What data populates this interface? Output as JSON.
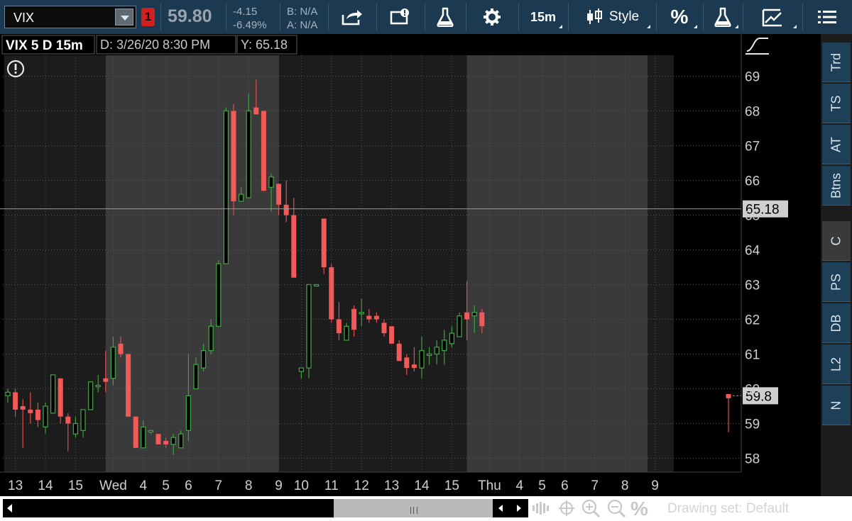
{
  "toolbar": {
    "symbol": "VIX",
    "alert_badge": "1",
    "last_price": "59.80",
    "net_change": "-4.15",
    "pct_change": "-6.49%",
    "bid": "B: N/A",
    "ask": "A: N/A",
    "timeframe_label": "15m",
    "style_label": "Style",
    "percent_label": "%",
    "icons": [
      "share-icon",
      "message-center-icon",
      "flask-icon",
      "gear-icon",
      "candle-style-icon",
      "flask-icon",
      "drawing-tools-icon",
      "menu-icon"
    ]
  },
  "chart_header": {
    "title": "VIX 5 D 15m",
    "date_readout": "D: 3/26/20 8:30 PM",
    "y_readout": "Y: 65.18"
  },
  "bottom": {
    "drawing_set": "Drawing set: Default"
  },
  "sidebar": {
    "tabs": [
      "Trd",
      "TS",
      "AT",
      "Btns",
      "C",
      "PS",
      "DB",
      "L2",
      "N"
    ],
    "active": "C"
  },
  "chart_data": {
    "type": "candlestick",
    "ylim": [
      57.7,
      69.5
    ],
    "y_ticks": [
      58,
      59,
      60,
      61,
      62,
      63,
      64,
      65,
      66,
      67,
      68,
      69
    ],
    "x_ticks": [
      {
        "label": "13",
        "i": 1
      },
      {
        "label": "14",
        "i": 5
      },
      {
        "label": "15",
        "i": 9
      },
      {
        "label": "Wed",
        "i": 14
      },
      {
        "label": "4",
        "i": 18
      },
      {
        "label": "5",
        "i": 21
      },
      {
        "label": "6",
        "i": 24
      },
      {
        "label": "7",
        "i": 28
      },
      {
        "label": "8",
        "i": 32
      },
      {
        "label": "9",
        "i": 36
      },
      {
        "label": "10",
        "i": 39
      },
      {
        "label": "11",
        "i": 43
      },
      {
        "label": "12",
        "i": 47
      },
      {
        "label": "13",
        "i": 51
      },
      {
        "label": "14",
        "i": 55
      },
      {
        "label": "15",
        "i": 59
      },
      {
        "label": "Thu",
        "i": 64
      },
      {
        "label": "4",
        "i": 68
      },
      {
        "label": "5",
        "i": 71
      },
      {
        "label": "6",
        "i": 74
      },
      {
        "label": "7",
        "i": 78
      },
      {
        "label": "8",
        "i": 82
      },
      {
        "label": "9",
        "i": 86
      }
    ],
    "session_shading": [
      {
        "from": 0,
        "to": 13,
        "tone": "dark"
      },
      {
        "from": 13.5,
        "to": 36.5,
        "tone": "light"
      },
      {
        "from": 36.5,
        "to": 61.5,
        "tone": "dark"
      },
      {
        "from": 61.5,
        "to": 85.5,
        "tone": "light"
      },
      {
        "from": 85.5,
        "to": 88,
        "tone": "dark"
      }
    ],
    "crosshair_value": 65.18,
    "crosshair_label": "65.18",
    "last_value": 59.8,
    "last_label": "59.8",
    "ohlc": [
      [
        59.8,
        60.0,
        59.6,
        59.9
      ],
      [
        59.9,
        60.0,
        59.2,
        59.4
      ],
      [
        59.5,
        59.7,
        58.3,
        59.4
      ],
      [
        59.4,
        59.9,
        59.0,
        59.3
      ],
      [
        59.4,
        59.6,
        58.9,
        59.1
      ],
      [
        58.9,
        59.6,
        58.7,
        59.5
      ],
      [
        59.3,
        60.4,
        59.3,
        60.4
      ],
      [
        60.3,
        60.3,
        59.0,
        59.2
      ],
      [
        59.2,
        59.3,
        58.2,
        59.0
      ],
      [
        58.7,
        59.2,
        58.6,
        59.0
      ],
      [
        58.8,
        59.3,
        58.6,
        59.4
      ],
      [
        59.4,
        60.2,
        59.4,
        60.2
      ],
      [
        60.1,
        60.4,
        59.9,
        60.1
      ],
      [
        60.3,
        61.1,
        59.9,
        60.2
      ],
      [
        60.3,
        61.5,
        60.1,
        61.2
      ],
      [
        61.3,
        61.5,
        60.9,
        61.0
      ],
      [
        61.0,
        61.0,
        59.2,
        59.2
      ],
      [
        59.2,
        59.2,
        58.3,
        58.3
      ],
      [
        58.3,
        59.1,
        58.3,
        58.9
      ],
      [
        58.8,
        58.8,
        58.7,
        58.8
      ],
      [
        58.7,
        58.7,
        58.4,
        58.4
      ],
      [
        58.5,
        58.6,
        58.3,
        58.4
      ],
      [
        58.4,
        58.7,
        58.1,
        58.6
      ],
      [
        58.3,
        58.8,
        58.3,
        58.7
      ],
      [
        58.8,
        61.0,
        58.5,
        59.8
      ],
      [
        60.0,
        60.9,
        60.0,
        60.7
      ],
      [
        60.6,
        61.3,
        60.5,
        61.1
      ],
      [
        61.1,
        62.0,
        61.0,
        61.8
      ],
      [
        61.8,
        63.7,
        61.8,
        63.6
      ],
      [
        63.6,
        68.1,
        63.6,
        68.0
      ],
      [
        68.0,
        68.2,
        65.0,
        65.4
      ],
      [
        65.4,
        65.8,
        65.4,
        65.6
      ],
      [
        65.5,
        68.5,
        65.5,
        68.0
      ],
      [
        68.1,
        68.9,
        68.0,
        67.9
      ],
      [
        68.0,
        68.0,
        65.8,
        65.7
      ],
      [
        65.8,
        66.2,
        65.1,
        66.1
      ],
      [
        65.9,
        65.9,
        65.0,
        65.3
      ],
      [
        65.3,
        66.0,
        64.8,
        65.0
      ],
      [
        65.0,
        65.5,
        63.2,
        63.2
      ],
      [
        60.5,
        60.6,
        60.3,
        60.6
      ],
      [
        60.6,
        63.0,
        60.3,
        63.0
      ],
      [
        63.0,
        63.0,
        63.0,
        63.0
      ],
      [
        64.9,
        64.9,
        63.3,
        63.5
      ],
      [
        63.5,
        63.6,
        61.9,
        62.0
      ],
      [
        62.0,
        62.5,
        61.4,
        61.6
      ],
      [
        61.4,
        61.9,
        61.4,
        61.8
      ],
      [
        62.3,
        62.4,
        61.5,
        61.7
      ],
      [
        62.2,
        62.6,
        61.8,
        62.2
      ],
      [
        62.1,
        62.3,
        61.9,
        62.0
      ],
      [
        62.1,
        62.2,
        61.9,
        62.0
      ],
      [
        61.9,
        62.0,
        61.5,
        61.6
      ],
      [
        61.8,
        61.8,
        61.3,
        61.3
      ],
      [
        61.3,
        61.4,
        60.8,
        60.8
      ],
      [
        60.9,
        61.0,
        60.4,
        60.6
      ],
      [
        60.7,
        61.2,
        60.5,
        60.6
      ],
      [
        60.6,
        61.5,
        60.3,
        61.1
      ],
      [
        61.0,
        61.2,
        60.7,
        61.0
      ],
      [
        61.0,
        61.4,
        60.7,
        61.2
      ],
      [
        61.1,
        61.7,
        60.7,
        61.4
      ],
      [
        61.3,
        61.8,
        61.2,
        61.6
      ],
      [
        61.5,
        62.2,
        61.5,
        62.1
      ],
      [
        62.2,
        63.1,
        61.4,
        62.0
      ],
      [
        62.1,
        62.4,
        61.6,
        62.2
      ],
      [
        62.2,
        62.3,
        61.6,
        61.8
      ]
    ]
  }
}
